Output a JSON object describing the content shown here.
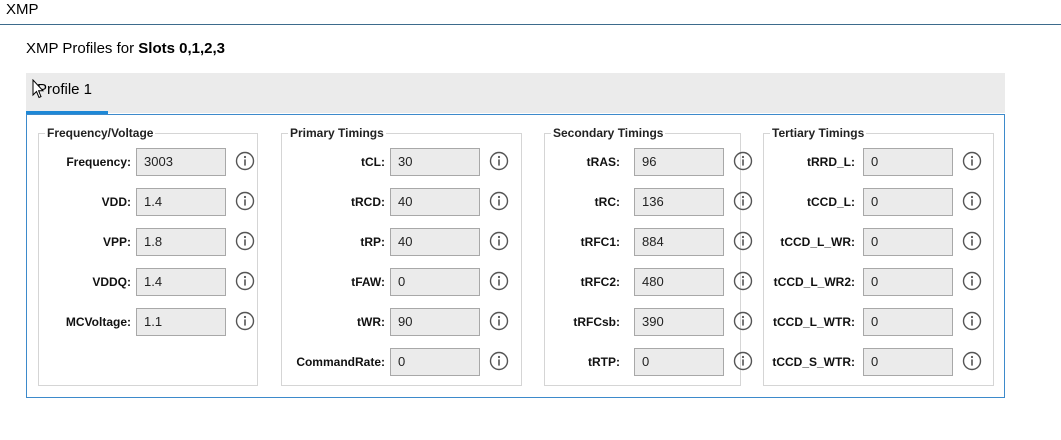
{
  "header": {
    "title": "XMP"
  },
  "subtitle": {
    "prefix": "XMP Profiles for ",
    "slots": "Slots 0,1,2,3"
  },
  "tabs": [
    {
      "label": "Profile 1"
    }
  ],
  "groups": [
    {
      "title": "Frequency/Voltage",
      "rows": [
        {
          "label": "Frequency:",
          "value": "3003"
        },
        {
          "label": "VDD:",
          "value": "1.4"
        },
        {
          "label": "VPP:",
          "value": "1.8"
        },
        {
          "label": "VDDQ:",
          "value": "1.4"
        },
        {
          "label": "MCVoltage:",
          "value": "1.1"
        }
      ]
    },
    {
      "title": "Primary Timings",
      "rows": [
        {
          "label": "tCL:",
          "value": "30"
        },
        {
          "label": "tRCD:",
          "value": "40"
        },
        {
          "label": "tRP:",
          "value": "40"
        },
        {
          "label": "tFAW:",
          "value": "0"
        },
        {
          "label": "tWR:",
          "value": "90"
        },
        {
          "label": "CommandRate:",
          "value": "0"
        }
      ]
    },
    {
      "title": "Secondary Timings",
      "rows": [
        {
          "label": "tRAS:",
          "value": "96"
        },
        {
          "label": "tRC:",
          "value": "136"
        },
        {
          "label": "tRFC1:",
          "value": "884"
        },
        {
          "label": "tRFC2:",
          "value": "480"
        },
        {
          "label": "tRFCsb:",
          "value": "390"
        },
        {
          "label": "tRTP:",
          "value": "0"
        }
      ]
    },
    {
      "title": "Tertiary Timings",
      "rows": [
        {
          "label": "tRRD_L:",
          "value": "0"
        },
        {
          "label": "tCCD_L:",
          "value": "0"
        },
        {
          "label": "tCCD_L_WR:",
          "value": "0"
        },
        {
          "label": "tCCD_L_WR2:",
          "value": "0"
        },
        {
          "label": "tCCD_L_WTR:",
          "value": "0"
        },
        {
          "label": "tCCD_S_WTR:",
          "value": "0"
        }
      ]
    }
  ],
  "icons": {
    "info": "info-circle-icon",
    "cursor": "mouse-pointer-icon"
  },
  "colors": {
    "accent": "#1e88d6",
    "border": "#3d8acb",
    "field_bg": "#ebebeb"
  }
}
